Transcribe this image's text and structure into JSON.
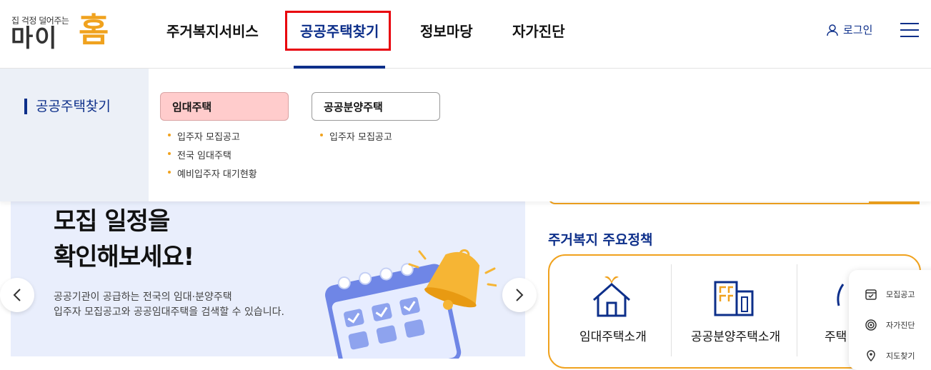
{
  "header": {
    "logo_tagline": "집 걱정 덜어주는",
    "logo_name": "마이",
    "logo_home": "홈",
    "nav": [
      "주거복지서비스",
      "공공주택찾기",
      "정보마당",
      "자가진단"
    ],
    "login_label": "로그인"
  },
  "mega_menu": {
    "section_title": "공공주택찾기",
    "categories": [
      {
        "label": "임대주택",
        "items": [
          "입주자 모집공고",
          "전국 임대주택",
          "예비입주자 대기현황"
        ]
      },
      {
        "label": "공공분양주택",
        "items": [
          "입주자 모집공고"
        ]
      }
    ]
  },
  "hero": {
    "headline_1": "모집 일정을",
    "headline_2": "확인해보세요!",
    "desc_1": "공공기관이 공급하는 전국의 임대·분양주택",
    "desc_2": "입주자 모집공고와 공공임대주택을 검색할 수 있습니다."
  },
  "policy": {
    "title": "주거복지 주요정책",
    "cards": [
      "임대주택소개",
      "공공분양주택소개",
      "주택"
    ]
  },
  "quick_menu": [
    "모집공고",
    "자가진단",
    "지도찾기"
  ],
  "colors": {
    "brand_navy": "#0d2f8a",
    "brand_orange": "#f0a21e",
    "highlight_red": "#e8000b",
    "rent_pink": "#ffcccc"
  }
}
